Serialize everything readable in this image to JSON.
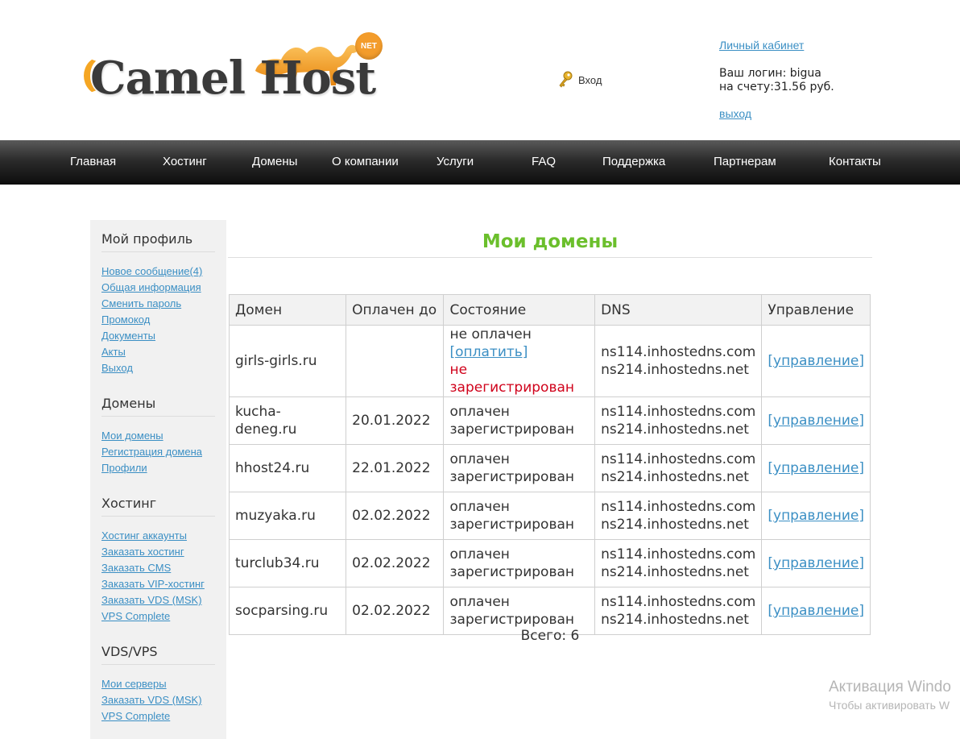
{
  "header": {
    "logo": {
      "text": "Camel Host",
      "badge": "NET"
    },
    "login_label": "Вход",
    "account": {
      "cabinet_link": "Личный кабинет",
      "login_text": "Ваш логин: bigua",
      "balance_text": "на счету:31.56 руб.",
      "logout_link": "выход"
    }
  },
  "nav": [
    "Главная",
    "Хостинг",
    "Домены",
    "О компании",
    "Услуги",
    "FAQ",
    "Поддержка",
    "Партнерам",
    "Контакты"
  ],
  "sidebar": {
    "sections": [
      {
        "title": "Мой профиль",
        "links": [
          "Новое сообщение(4)",
          "Общая информация",
          "Сменить пароль",
          "Промокод",
          "Документы",
          "Акты",
          "Выход"
        ]
      },
      {
        "title": "Домены",
        "links": [
          "Мои домены",
          "Регистрация домена",
          "Профили"
        ]
      },
      {
        "title": "Хостинг",
        "links": [
          "Хостинг аккаунты",
          "Заказать хостинг",
          "Заказать CMS",
          "Заказать VIP-хостинг",
          "Заказать VDS (MSK)",
          "VPS Complete"
        ]
      },
      {
        "title": "VDS/VPS",
        "links": [
          "Мои серверы",
          "Заказать VDS (MSK)",
          "VPS Complete"
        ]
      }
    ]
  },
  "main": {
    "title": "Мои домены",
    "columns": [
      "Домен",
      "Оплачен до",
      "Состояние",
      "DNS",
      "Управление"
    ],
    "rows": [
      {
        "domain": "girls-girls.ru",
        "paid_until": "",
        "status": "не оплачен",
        "pay_link": "[оплатить]",
        "reg_status": "не зарегистрирован",
        "dns1": "ns114.inhostedns.com",
        "dns2": "ns214.inhostedns.net",
        "manage": "[управление]"
      },
      {
        "domain": "kucha-deneg.ru",
        "paid_until": "20.01.2022",
        "status": "оплачен",
        "reg_status": "зарегистрирован",
        "dns1": "ns114.inhostedns.com",
        "dns2": "ns214.inhostedns.net",
        "manage": "[управление]"
      },
      {
        "domain": "hhost24.ru",
        "paid_until": "22.01.2022",
        "status": "оплачен",
        "reg_status": "зарегистрирован",
        "dns1": "ns114.inhostedns.com",
        "dns2": "ns214.inhostedns.net",
        "manage": "[управление]"
      },
      {
        "domain": "muzyaka.ru",
        "paid_until": "02.02.2022",
        "status": "оплачен",
        "reg_status": "зарегистрирован",
        "dns1": "ns114.inhostedns.com",
        "dns2": "ns214.inhostedns.net",
        "manage": "[управление]"
      },
      {
        "domain": "turclub34.ru",
        "paid_until": "02.02.2022",
        "status": "оплачен",
        "reg_status": "зарегистрирован",
        "dns1": "ns114.inhostedns.com",
        "dns2": "ns214.inhostedns.net",
        "manage": "[управление]"
      },
      {
        "domain": "socparsing.ru",
        "paid_until": "02.02.2022",
        "status": "оплачен",
        "reg_status": "зарегистрирован",
        "dns1": "ns114.inhostedns.com",
        "dns2": "ns214.inhostedns.net",
        "manage": "[управление]"
      }
    ],
    "total": "Всего: 6"
  },
  "watermark": {
    "line1": "Активация Windo",
    "line2": "Чтобы активировать W"
  },
  "colors": {
    "title_green": "#6bbf2c",
    "link_blue": "#3b8fc4",
    "error_red": "#d0021b",
    "nav_dark": "#1a1a1a"
  }
}
